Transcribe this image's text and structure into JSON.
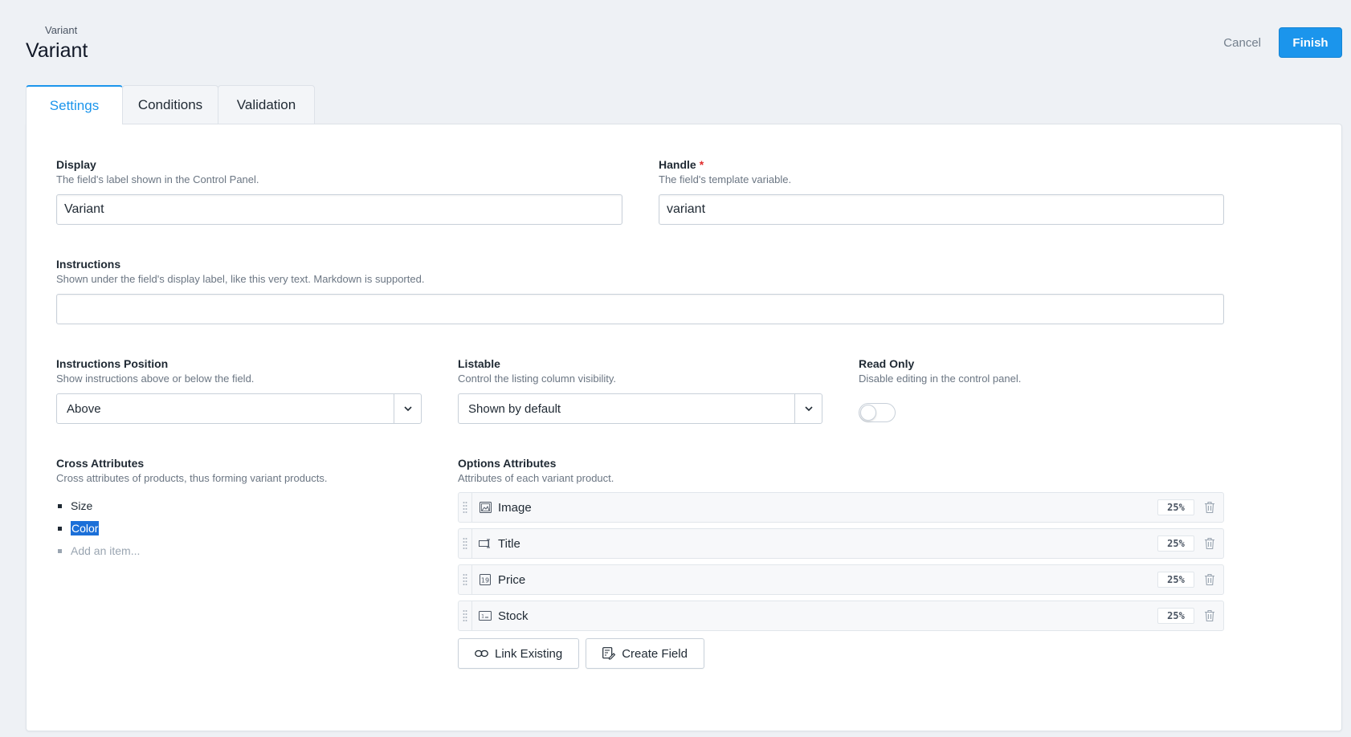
{
  "header": {
    "breadcrumb": "Variant",
    "title": "Variant"
  },
  "actions": {
    "cancel": "Cancel",
    "finish": "Finish"
  },
  "tabs": [
    {
      "label": "Settings",
      "active": true
    },
    {
      "label": "Conditions",
      "active": false
    },
    {
      "label": "Validation",
      "active": false
    }
  ],
  "fields": {
    "display": {
      "label": "Display",
      "help": "The field's label shown in the Control Panel.",
      "value": "Variant"
    },
    "handle": {
      "label": "Handle",
      "required_mark": "*",
      "help": "The field's template variable.",
      "value": "variant"
    },
    "instructions": {
      "label": "Instructions",
      "help": "Shown under the field's display label, like this very text. Markdown is supported.",
      "value": ""
    },
    "instructions_position": {
      "label": "Instructions Position",
      "help": "Show instructions above or below the field.",
      "value": "Above"
    },
    "listable": {
      "label": "Listable",
      "help": "Control the listing column visibility.",
      "value": "Shown by default"
    },
    "read_only": {
      "label": "Read Only",
      "help": "Disable editing in the control panel.",
      "enabled": false
    },
    "cross_attributes": {
      "label": "Cross Attributes",
      "help": "Cross attributes of products, thus forming variant products.",
      "items": [
        "Size",
        "Color"
      ],
      "add_placeholder": "Add an item..."
    },
    "options_attributes": {
      "label": "Options Attributes",
      "help": "Attributes of each variant product.",
      "rows": [
        {
          "label": "Image",
          "icon": "image-icon",
          "width": "25%"
        },
        {
          "label": "Title",
          "icon": "text-field-icon",
          "width": "25%"
        },
        {
          "label": "Price",
          "icon": "number-icon",
          "width": "25%"
        },
        {
          "label": "Stock",
          "icon": "integer-icon",
          "width": "25%"
        }
      ],
      "link_existing": "Link Existing",
      "create_field": "Create Field"
    }
  },
  "colors": {
    "accent": "#1b95ec",
    "background": "#eef1f5",
    "required": "#e02d2d"
  }
}
